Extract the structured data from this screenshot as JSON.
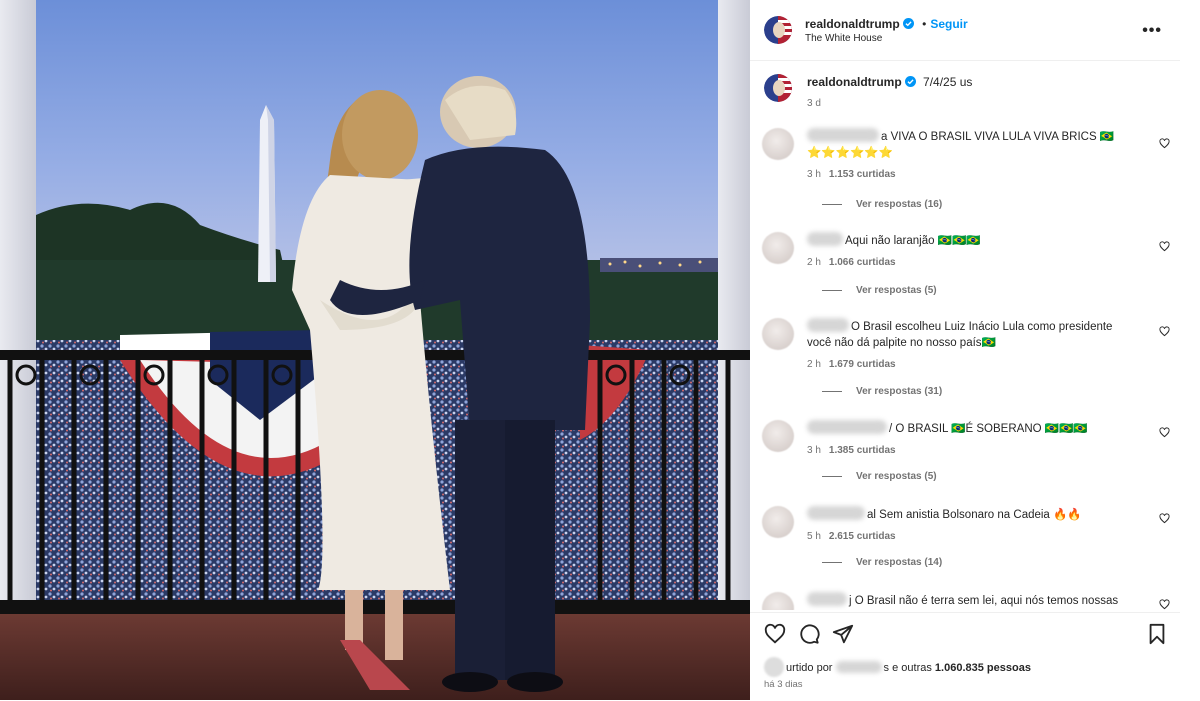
{
  "post": {
    "username": "realdonaldtrump",
    "follow_label": "Seguir",
    "location": "The White House",
    "more_label": "•••"
  },
  "caption": {
    "username": "realdonaldtrump",
    "text": "7/4/25 us",
    "age": "3 d"
  },
  "comments": [
    {
      "text": "a VIVA O BRASIL VIVA LULA VIVA BRICS 🇧🇷",
      "line2": "⭐⭐⭐⭐⭐⭐",
      "time": "3 h",
      "likes": "1.153 curtidas",
      "replies": "Ver respostas (16)"
    },
    {
      "text": "Aqui não laranjão 🇧🇷🇧🇷🇧🇷",
      "line2": "",
      "time": "2 h",
      "likes": "1.066 curtidas",
      "replies": "Ver respostas (5)"
    },
    {
      "text": "O Brasil escolheu Luiz Inácio Lula como presidente",
      "line2": "você não dá palpite no nosso país🇧🇷",
      "time": "2 h",
      "likes": "1.679 curtidas",
      "replies": "Ver respostas (31)"
    },
    {
      "text": "/ O BRASIL 🇧🇷É SOBERANO 🇧🇷🇧🇷🇧🇷",
      "line2": "",
      "time": "3 h",
      "likes": "1.385 curtidas",
      "replies": "Ver respostas (5)"
    },
    {
      "text": "al Sem anistia Bolsonaro na Cadeia 🔥🔥",
      "line2": "",
      "time": "5 h",
      "likes": "2.615 curtidas",
      "replies": "Ver respostas (14)"
    },
    {
      "text": "j O Brasil não é terra sem lei, aqui nós temos nossas",
      "line2": "",
      "time": "",
      "likes": "",
      "replies": ""
    }
  ],
  "footer": {
    "liked_prefix": "urtido por",
    "liked_suffix": "s e outras",
    "liked_count": "1.060.835 pessoas",
    "date": "há 3 dias"
  },
  "icons": {
    "like": "heart-icon",
    "comment": "comment-icon",
    "share": "send-icon",
    "save": "bookmark-icon",
    "more": "more-options-icon",
    "verified": "verified-badge-icon"
  },
  "colors": {
    "accent": "#0095f6",
    "verified": "#0095f6",
    "muted": "#737373",
    "text": "#262626"
  }
}
